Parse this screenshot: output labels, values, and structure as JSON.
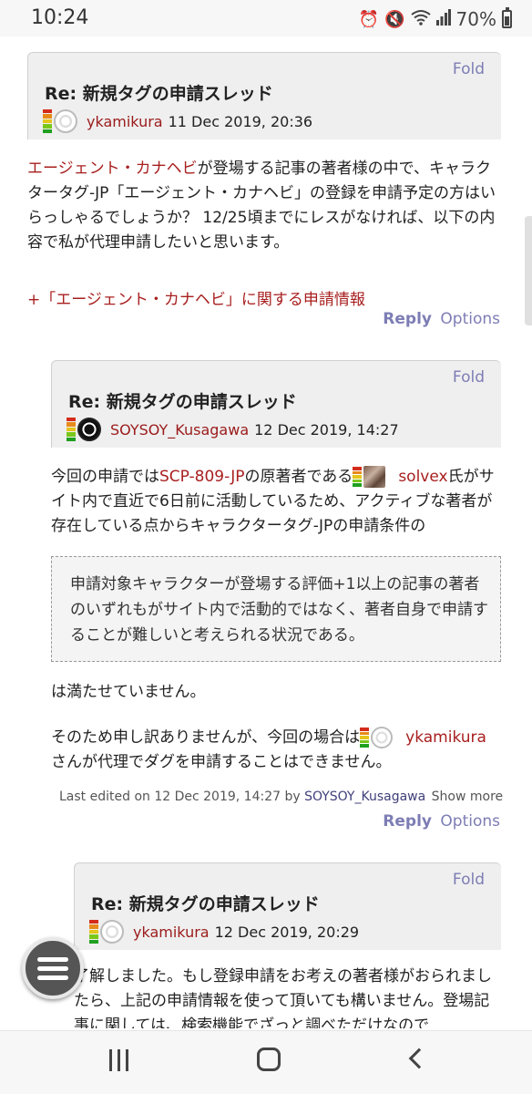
{
  "status_bar": {
    "time": "10:24",
    "icons": [
      "alarm-icon",
      "mute-icon",
      "wifi-icon",
      "signal-icon"
    ],
    "battery": "70%"
  },
  "posts": [
    {
      "fold": "Fold",
      "title": "Re: 新規タグの申請スレッド",
      "author": "ykamikura",
      "date": "11 Dec 2019, 20:36",
      "body_link": "エージェント・カナヘビ",
      "body_rest": "が登場する記事の著者様の中で、キャラクタータグ-JP「エージェント・カナヘビ」の登録を申請予定の方はいらっしゃるでしょうか？ 12/25頃までにレスがなければ、以下の内容で私が代理申請したいと思います。",
      "expand": "+「エージェント・カナヘビ」に関する申請情報",
      "reply": "Reply",
      "options": "Options"
    },
    {
      "fold": "Fold",
      "title": "Re: 新規タグの申請スレッド",
      "author": "SOYSOY_Kusagawa",
      "date": "12 Dec 2019, 14:27",
      "p1_a": "今回の申請では",
      "p1_link": "SCP-809-JP",
      "p1_b": "の原著者である",
      "p1_user": "solvex",
      "p1_c": "氏がサイト内で直近で6日前に活動しているため、アクティブな著者が存在している点からキャラクタータグ-JPの申請条件の",
      "quote": "申請対象キャラクターが登場する評価+1以上の記事の著者のいずれもがサイト内で活動的ではなく、著者自身で申請することが難しいと考えられる状況である。",
      "p2": "は満たせていません。",
      "p3_a": "そのため申し訳ありませんが、今回の場合は",
      "p3_user": "ykamikura",
      "p3_b": "さんが代理でダグを申請することはできません。",
      "edited_prefix": "Last edited on 12 Dec 2019, 14:27 by",
      "edited_by": "SOYSOY_Kusagawa",
      "show_more": "Show more",
      "reply": "Reply",
      "options": "Options"
    },
    {
      "fold": "Fold",
      "title": "Re: 新規タグの申請スレッド",
      "author": "ykamikura",
      "date": "12 Dec 2019, 20:29",
      "body": "了解しました。もし登録申請をお考えの著者様がおられましたら、上記の申請情報を使って頂いても構いません。登場記事に関しては、検索機能でざっと調べただけなので"
    }
  ],
  "nav": {
    "icons": [
      "recent-apps-icon",
      "home-icon",
      "back-icon"
    ]
  }
}
